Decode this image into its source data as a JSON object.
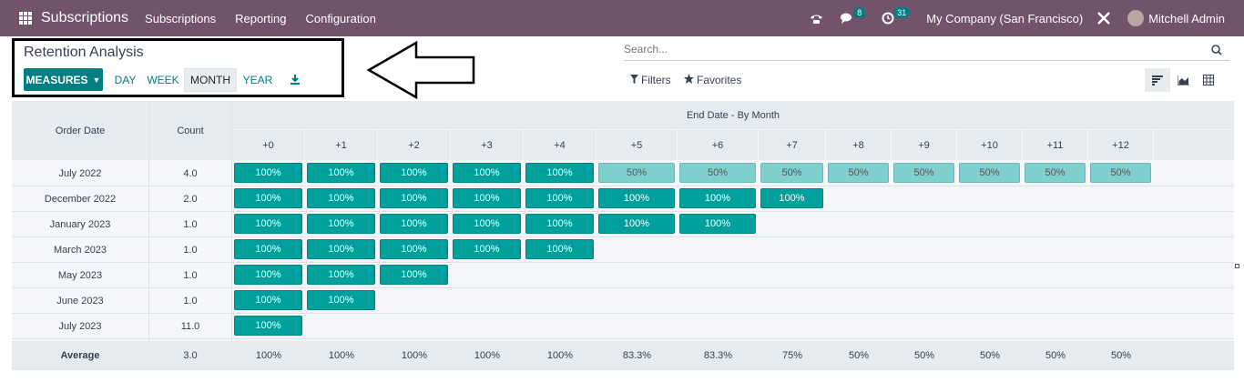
{
  "navbar": {
    "app_title": "Subscriptions",
    "menus": [
      "Subscriptions",
      "Reporting",
      "Configuration"
    ],
    "chat_badge": "8",
    "activity_badge": "31",
    "company": "My Company (San Francisco)",
    "user": "Mitchell Admin"
  },
  "control_panel": {
    "title": "Retention Analysis",
    "measures_label": "MEASURES",
    "intervals": [
      "DAY",
      "WEEK",
      "MONTH",
      "YEAR"
    ],
    "active_interval": "MONTH",
    "search_placeholder": "Search...",
    "filters_label": "Filters",
    "favorites_label": "Favorites"
  },
  "table": {
    "col_order_date": "Order Date",
    "col_count": "Count",
    "end_date_header": "End Date - By Month",
    "offsets": [
      "+0",
      "+1",
      "+2",
      "+3",
      "+4",
      "+5",
      "+6",
      "+7",
      "+8",
      "+9",
      "+10",
      "+11",
      "+12"
    ],
    "rows": [
      {
        "label": "July 2022",
        "count": "4.0",
        "values": [
          "100%",
          "100%",
          "100%",
          "100%",
          "100%",
          "50%",
          "50%",
          "50%",
          "50%",
          "50%",
          "50%",
          "50%",
          "50%"
        ]
      },
      {
        "label": "December 2022",
        "count": "2.0",
        "values": [
          "100%",
          "100%",
          "100%",
          "100%",
          "100%",
          "100%",
          "100%",
          "100%"
        ]
      },
      {
        "label": "January 2023",
        "count": "1.0",
        "values": [
          "100%",
          "100%",
          "100%",
          "100%",
          "100%",
          "100%",
          "100%"
        ]
      },
      {
        "label": "March 2023",
        "count": "1.0",
        "values": [
          "100%",
          "100%",
          "100%",
          "100%",
          "100%"
        ]
      },
      {
        "label": "May 2023",
        "count": "1.0",
        "values": [
          "100%",
          "100%",
          "100%"
        ]
      },
      {
        "label": "June 2023",
        "count": "1.0",
        "values": [
          "100%",
          "100%"
        ]
      },
      {
        "label": "July 2023",
        "count": "11.0",
        "values": [
          "100%"
        ]
      }
    ],
    "average_label": "Average",
    "average_count": "3.0",
    "averages": [
      "100%",
      "100%",
      "100%",
      "100%",
      "100%",
      "83.3%",
      "83.3%",
      "75%",
      "50%",
      "50%",
      "50%",
      "50%",
      "50%"
    ]
  },
  "colors": {
    "navbar": "#71536a",
    "primary": "#017e84",
    "cell_full": "#00a09d",
    "cell_half": "#7fcfcc"
  }
}
